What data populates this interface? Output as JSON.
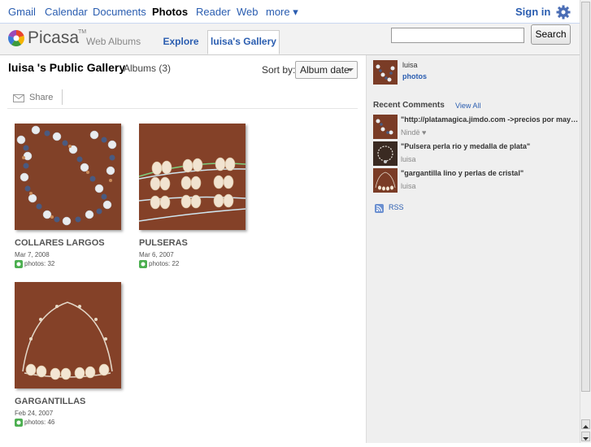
{
  "topnav": {
    "links": [
      "Gmail",
      "Calendar",
      "Documents",
      "Photos",
      "Reader",
      "Web",
      "more ▾"
    ],
    "active": "Photos",
    "signin": "Sign in"
  },
  "header": {
    "logo_text": "Picasa",
    "logo_tm": "TM",
    "logo_sub": "Web Albums",
    "tabs": [
      "Explore",
      "luisa's Gallery"
    ],
    "search_button": "Search",
    "search_value": ""
  },
  "gallery": {
    "title": "luisa 's Public Gallery",
    "albums_count": "Albums (3)",
    "sortby_label": "Sort by:",
    "sort_value": "Album date",
    "share_label": "Share"
  },
  "albums": [
    {
      "name": "COLLARES LARGOS",
      "date": "Mar 7, 2008",
      "photos": "photos: 32"
    },
    {
      "name": "PULSERAS",
      "date": "Mar 6, 2007",
      "photos": "photos: 22"
    },
    {
      "name": "GARGANTILLAS",
      "date": "Feb 24, 2007",
      "photos": "photos: 46"
    }
  ],
  "sidebar": {
    "owner_name": "luisa",
    "owner_photos": "photos",
    "recent_comments_title": "Recent Comments",
    "view_all": "View All",
    "comments": [
      {
        "text": "\"http://platamagica.jimdo.com ->precios por mayor\"",
        "author": "Nindë ♥"
      },
      {
        "text": "\"Pulsera perla rio y medalla de plata\"",
        "author": "luisa"
      },
      {
        "text": "\"gargantilla lino y perlas de cristal\"",
        "author": "luisa"
      }
    ],
    "rss": "RSS"
  },
  "colors": {
    "link": "#2a5db0",
    "thumb_bg": "#7a3c26",
    "sidebar_bg": "#efefef"
  }
}
